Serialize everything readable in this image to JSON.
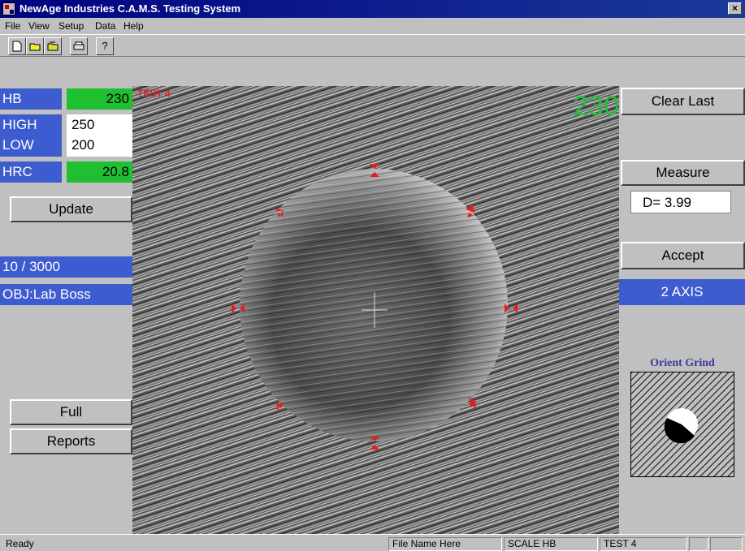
{
  "window": {
    "title": "NewAge Industries C.A.M.S. Testing System",
    "close_label": "×"
  },
  "menu": [
    "File",
    "View",
    "Setup",
    "Data",
    "Help"
  ],
  "toolbar": {
    "help_label": "?"
  },
  "left": {
    "hb_label": "HB",
    "hb_value": "230",
    "high_label": "HIGH",
    "high_value": "250",
    "low_label": "LOW",
    "low_value": "200",
    "hrc_label": "HRC",
    "hrc_value": "20.8",
    "update_label": "Update",
    "load_info": "10 / 3000",
    "objective_info": "OBJ:Lab Boss",
    "full_label": "Full",
    "reports_label": "Reports"
  },
  "image": {
    "reading": "230",
    "test_tag": "TEST 4"
  },
  "right": {
    "clear_last_label": "Clear Last",
    "measure_label": "Measure",
    "diameter_readout": "D=  3.99",
    "accept_label": "Accept",
    "axis_mode": "2 AXIS",
    "orient_grind_label": "Orient Grind"
  },
  "status": {
    "ready": "Ready",
    "file_name": "File Name Here",
    "scale": "SCALE HB",
    "test": "TEST 4"
  },
  "colors": {
    "label_blue": "#3d5ccf",
    "value_green": "#1fc02f",
    "reading_green": "#1fbf3a",
    "marker_red": "#e02020"
  }
}
